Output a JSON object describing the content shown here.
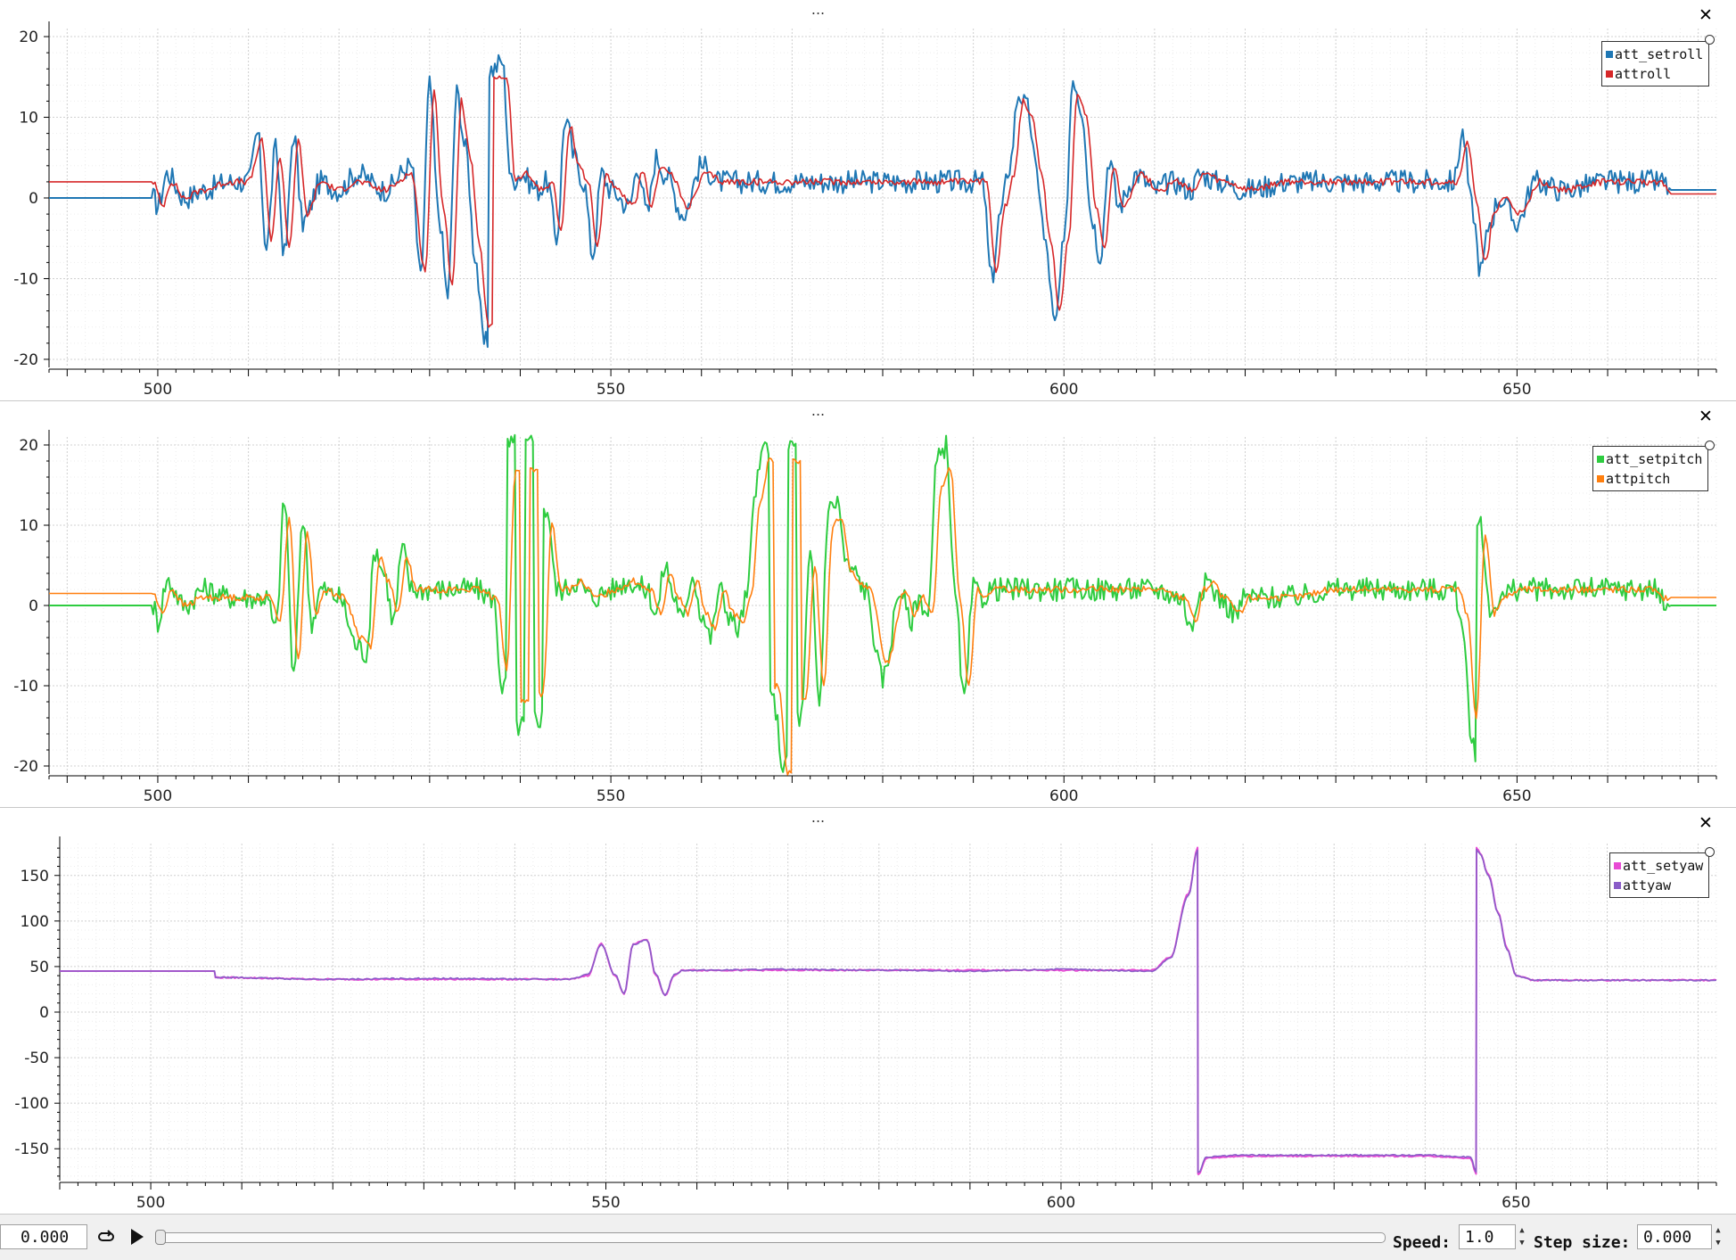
{
  "panels": [
    {
      "menu": "...",
      "close_glyph": "✕",
      "x_ticks": [
        "500",
        "550",
        "600",
        "650"
      ],
      "y_ticks": [
        "20",
        "10",
        "0",
        "-10",
        "-20"
      ],
      "legend": [
        {
          "label": "att_setroll",
          "color": "#1f77b4"
        },
        {
          "label": "attroll",
          "color": "#d62728"
        }
      ]
    },
    {
      "menu": "...",
      "close_glyph": "✕",
      "x_ticks": [
        "500",
        "550",
        "600",
        "650"
      ],
      "y_ticks": [
        "20",
        "10",
        "0",
        "-10",
        "-20"
      ],
      "legend": [
        {
          "label": "att_setpitch",
          "color": "#2ecc40"
        },
        {
          "label": "attpitch",
          "color": "#ff7f0e"
        }
      ]
    },
    {
      "menu": "...",
      "close_glyph": "✕",
      "x_ticks": [
        "500",
        "550",
        "600",
        "650"
      ],
      "y_ticks": [
        "150",
        "100",
        "50",
        "0",
        "-50",
        "-100",
        "-150"
      ],
      "legend": [
        {
          "label": "att_setyaw",
          "color": "#e84bd4"
        },
        {
          "label": "attyaw",
          "color": "#8a5cc8"
        }
      ]
    }
  ],
  "chart_data": [
    {
      "type": "line",
      "xlim": [
        488,
        672
      ],
      "ylim": [
        -21,
        21
      ],
      "series": [
        {
          "name": "att_setroll",
          "color": "#1f77b4",
          "x": [
            488,
            498,
            499.5,
            500,
            501,
            503,
            505,
            508,
            510,
            511,
            512,
            513,
            514,
            515,
            516,
            518,
            520,
            522,
            525,
            528,
            529,
            530,
            531,
            532,
            533,
            534,
            535,
            536,
            537,
            538,
            539,
            540,
            542,
            543,
            544,
            545,
            546,
            547,
            548,
            549,
            550,
            552,
            553,
            554,
            555,
            556,
            558,
            560,
            562,
            565,
            570,
            575,
            580,
            585,
            588,
            591,
            592,
            593,
            594,
            595,
            596,
            597,
            598,
            599,
            600,
            601,
            602,
            603,
            604,
            605,
            606,
            608,
            610,
            612,
            614,
            615,
            617,
            620,
            625,
            630,
            635,
            640,
            643,
            644,
            645,
            646,
            647,
            648,
            650,
            652,
            655,
            660,
            665,
            666,
            667,
            672
          ],
          "y": [
            0,
            0,
            0,
            -1,
            3,
            0,
            1,
            2,
            2,
            8,
            -6,
            6,
            -7,
            8,
            -3,
            2,
            1,
            3,
            1,
            4,
            -10,
            14,
            -2,
            -12,
            13,
            6,
            -7,
            -18,
            16,
            17,
            2,
            3,
            1,
            2,
            -5,
            10,
            5,
            2,
            -7,
            3,
            1,
            -1,
            4,
            -2,
            5,
            3,
            -2,
            4,
            2,
            2,
            2,
            2,
            2,
            2,
            2,
            2,
            -10,
            -2,
            4,
            13,
            11,
            3,
            -6,
            -16,
            -6,
            15,
            11,
            -2,
            -7,
            5,
            -1,
            3,
            1,
            2,
            1,
            3,
            2,
            1,
            2,
            2,
            2,
            2,
            2,
            8,
            -1,
            -9,
            -3,
            0,
            -3,
            2,
            1,
            2,
            2,
            2,
            1,
            1
          ]
        },
        {
          "name": "attroll",
          "color": "#d62728",
          "x": [
            488,
            499.5,
            500.5,
            501.5,
            503,
            505,
            508,
            510,
            511.5,
            512.5,
            513.5,
            514.5,
            515.5,
            516.5,
            518,
            520,
            522,
            525,
            528,
            529.5,
            530.5,
            531.5,
            532.5,
            533.5,
            534.5,
            535.5,
            536.5,
            537.5,
            538.5,
            539.5,
            540.5,
            542.5,
            543.5,
            544.5,
            545.5,
            546.5,
            547.5,
            548.5,
            549.5,
            550.5,
            552.5,
            553.5,
            554.5,
            555.5,
            556.5,
            558.5,
            560.5,
            562.5,
            565,
            570,
            575,
            580,
            585,
            588.5,
            591.5,
            592.5,
            593.5,
            594.5,
            595.5,
            596.5,
            597.5,
            598.5,
            599.5,
            600.5,
            601.5,
            602.5,
            603.5,
            604.5,
            605.5,
            606.5,
            608.5,
            610.5,
            612.5,
            614.5,
            615.5,
            617.5,
            620.5,
            625,
            630,
            635,
            640,
            643.5,
            644.5,
            645.5,
            646.5,
            647.5,
            648.5,
            650.5,
            652.5,
            655,
            660,
            665,
            666,
            667,
            672
          ],
          "y": [
            2,
            2,
            -1,
            2,
            0,
            1,
            2,
            2,
            7,
            -5,
            5,
            -6,
            7,
            -2,
            2,
            1,
            2,
            1,
            3,
            -9,
            13,
            -1,
            -11,
            12,
            5,
            -6,
            -16,
            15,
            15,
            2,
            3,
            1,
            2,
            -4,
            9,
            4,
            2,
            -6,
            3,
            1,
            -1,
            3,
            -1,
            4,
            3,
            -1,
            3,
            2,
            2,
            2,
            2,
            2,
            2,
            2,
            2,
            -9,
            -1,
            3,
            12,
            10,
            3,
            -5,
            -14,
            -5,
            13,
            10,
            -1,
            -6,
            4,
            -1,
            3,
            1,
            2,
            1,
            3,
            2,
            1,
            2,
            2,
            2,
            2,
            2,
            7,
            0,
            -8,
            -2,
            0,
            -2,
            2,
            1,
            2,
            2,
            2,
            0.5,
            0.5
          ]
        }
      ]
    },
    {
      "type": "line",
      "xlim": [
        488,
        672
      ],
      "ylim": [
        -21,
        21
      ],
      "series": [
        {
          "name": "att_setpitch",
          "color": "#2ecc40",
          "x": [
            488,
            499.5,
            500,
            501,
            503,
            505,
            508,
            510,
            512,
            513,
            514,
            515,
            516,
            517,
            518,
            520,
            522,
            523,
            524,
            525,
            526,
            527,
            528,
            530,
            535,
            537,
            538,
            539,
            540,
            541,
            542,
            543,
            544,
            545,
            546,
            548,
            550,
            552,
            554,
            555,
            556,
            557,
            558,
            559,
            560,
            561,
            562,
            563,
            564,
            565,
            566,
            567,
            568,
            569,
            570,
            571,
            572,
            573,
            574,
            575,
            576,
            577,
            578,
            580,
            582,
            583,
            584,
            585,
            586,
            587,
            588,
            589,
            590,
            591,
            592,
            594,
            596,
            600,
            605,
            610,
            613,
            614,
            615,
            616,
            617,
            619,
            620,
            625,
            630,
            635,
            640,
            642,
            643,
            644,
            645,
            646,
            647,
            648,
            650,
            655,
            660,
            665,
            666,
            667,
            672
          ],
          "y": [
            0,
            0,
            -2,
            3,
            0,
            2,
            1,
            1,
            1,
            -3,
            13,
            -9,
            11,
            -2,
            2,
            1,
            -5,
            -6,
            7,
            4,
            -2,
            7,
            2,
            2,
            2,
            1,
            -10,
            20,
            -15,
            20,
            -14,
            12,
            2,
            2,
            3,
            1,
            2,
            3,
            2,
            -1,
            5,
            1,
            -2,
            4,
            -1,
            -4,
            2,
            -1,
            -3,
            1,
            15,
            20,
            -12,
            -20,
            20,
            -14,
            6,
            -12,
            12,
            13,
            5,
            4,
            2,
            -9,
            2,
            -2,
            1,
            -1,
            18,
            20,
            1,
            -12,
            2,
            1,
            2,
            2,
            2,
            2,
            2,
            2,
            1,
            -3,
            2,
            3,
            1,
            -1,
            1,
            1,
            2,
            2,
            2,
            2,
            2,
            -2,
            -18,
            10,
            -1,
            1,
            2,
            2,
            2,
            2,
            1,
            0,
            0
          ]
        },
        {
          "name": "attpitch",
          "color": "#ff7f0e",
          "x": [
            488,
            499.5,
            500.5,
            501.5,
            503,
            505,
            508,
            510,
            512.5,
            513.5,
            514.5,
            515.5,
            516.5,
            517.5,
            518.5,
            520.5,
            522.5,
            523.5,
            524.5,
            525.5,
            526.5,
            527.5,
            528.5,
            530.5,
            535,
            537.5,
            538.5,
            539.5,
            540.5,
            541.5,
            542.5,
            543.5,
            544.5,
            545.5,
            546.5,
            548.5,
            550.5,
            552.5,
            554.5,
            555.5,
            556.5,
            557.5,
            558.5,
            559.5,
            560.5,
            561.5,
            562.5,
            563.5,
            564.5,
            565.5,
            566.5,
            567.5,
            568.5,
            569.5,
            570.5,
            571.5,
            572.5,
            573.5,
            574.5,
            575.5,
            576.5,
            577.5,
            578.5,
            580.5,
            582.5,
            583.5,
            584.5,
            585.5,
            586.5,
            587.5,
            588.5,
            589.5,
            590.5,
            591.5,
            592.5,
            594.5,
            596.5,
            600.5,
            605,
            610,
            613.5,
            614.5,
            615.5,
            616.5,
            617.5,
            619.5,
            620.5,
            625,
            630,
            635,
            640,
            642.5,
            643.5,
            644.5,
            645.5,
            646.5,
            647.5,
            648.5,
            650.5,
            655,
            660,
            665,
            666,
            667,
            672
          ],
          "y": [
            1.5,
            1.5,
            -1,
            2,
            0,
            1,
            1,
            1,
            1,
            -2,
            11,
            -7,
            9,
            -1,
            2,
            1,
            -4,
            -5,
            6,
            3,
            -1,
            6,
            2,
            2,
            2,
            1,
            -8,
            17,
            -12,
            17,
            -11,
            10,
            2,
            2,
            3,
            1,
            2,
            3,
            2,
            -1,
            4,
            1,
            -1,
            3,
            -1,
            -3,
            2,
            -1,
            -2,
            1,
            13,
            18,
            -10,
            -21,
            18,
            -12,
            5,
            -10,
            10,
            11,
            4,
            3,
            2,
            -7,
            2,
            -1,
            1,
            -1,
            15,
            17,
            1,
            -10,
            2,
            1,
            2,
            2,
            2,
            2,
            2,
            2,
            1,
            -2,
            2,
            3,
            1,
            -1,
            1,
            1,
            2,
            2,
            2,
            2,
            2,
            -1,
            -14,
            9,
            -1,
            1,
            2,
            2,
            2,
            2,
            1,
            1,
            1
          ]
        }
      ]
    },
    {
      "type": "line",
      "xlim": [
        490,
        672
      ],
      "ylim": [
        -185,
        185
      ],
      "series": [
        {
          "name": "att_setyaw",
          "color": "#e84bd4",
          "x": [
            490,
            507,
            507.1,
            520,
            530,
            546,
            548,
            549.5,
            551,
            552,
            553,
            554.5,
            555.5,
            556.5,
            557.5,
            558.5,
            560,
            570,
            580,
            590,
            600,
            610,
            612,
            614,
            615,
            615.1,
            616,
            620,
            630,
            640,
            645,
            645.6,
            645.7,
            646,
            647,
            648,
            649,
            650,
            652,
            660,
            672
          ],
          "y": [
            45,
            45,
            38,
            36,
            36,
            36,
            40,
            75,
            40,
            20,
            75,
            80,
            40,
            18,
            40,
            46,
            46,
            46,
            46,
            46,
            46,
            46,
            60,
            130,
            180,
            -178,
            -160,
            -158,
            -158,
            -158,
            -160,
            -178,
            180,
            175,
            150,
            110,
            70,
            40,
            35,
            35,
            35
          ]
        },
        {
          "name": "attyaw",
          "color": "#8a5cc8",
          "x": [
            490,
            507,
            507.1,
            520,
            530,
            546,
            548,
            549.5,
            551,
            552,
            553,
            554.5,
            555.5,
            556.5,
            557.5,
            558.5,
            560,
            570,
            580,
            590,
            600,
            610,
            612,
            614,
            615,
            615.1,
            616,
            620,
            630,
            640,
            645,
            645.6,
            645.7,
            646,
            647,
            648,
            649,
            650,
            652,
            660,
            672
          ],
          "y": [
            45,
            45,
            38,
            36,
            37,
            36,
            41,
            74,
            41,
            21,
            74,
            79,
            41,
            19,
            41,
            46,
            46,
            47,
            46,
            45,
            47,
            45,
            59,
            128,
            178,
            -176,
            -159,
            -157,
            -157,
            -157,
            -159,
            -176,
            178,
            174,
            149,
            109,
            69,
            40,
            35,
            35,
            35
          ]
        }
      ]
    }
  ],
  "toolbar": {
    "time_value": "0.000",
    "loop_icon": "loop-icon",
    "play_icon": "play-icon",
    "speed_label": "Speed:",
    "speed_value": "1.0",
    "step_label": "Step size:",
    "step_value": "0.000"
  }
}
